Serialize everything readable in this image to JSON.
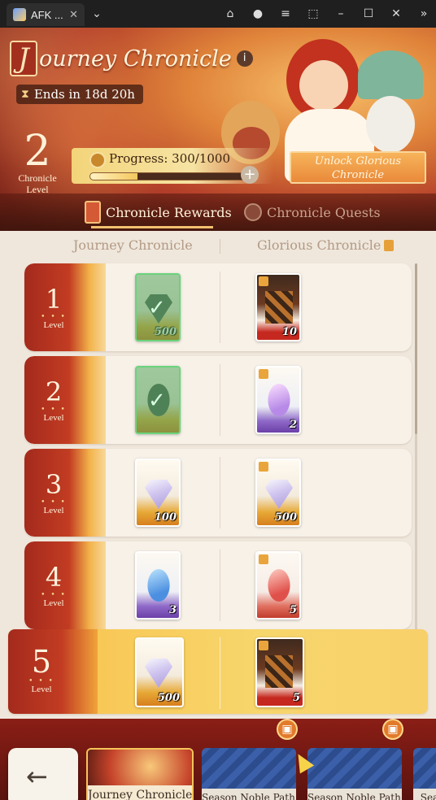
{
  "window": {
    "tab_title": "AFK ...",
    "close_glyph": "✕",
    "dropdown_glyph": "⌄",
    "controls": [
      "gift-icon",
      "account-icon",
      "menu-icon",
      "screenshot-icon",
      "minimize-icon",
      "maximize-icon",
      "close-icon",
      "chevron-right-icon"
    ]
  },
  "header": {
    "title_initial": "J",
    "title_rest": "ourney Chronicle",
    "info_label": "i",
    "ends_text": "Ends in 18d 20h",
    "level_number": "2",
    "level_caption_1": "Chronicle",
    "level_caption_2": "Level",
    "progress_text": "Progress: 300/1000",
    "progress_fraction": 0.3,
    "plus_label": "+",
    "unlock_button_line1": "Unlock Glorious",
    "unlock_button_line2": "Chronicle"
  },
  "tabs": [
    {
      "label": "Chronicle Rewards",
      "active": true
    },
    {
      "label": "Chronicle Quests",
      "active": false
    }
  ],
  "columns": {
    "left": "Journey Chronicle",
    "right": "Glorious Chronicle"
  },
  "rows": [
    {
      "level": "1",
      "level_label": "Level",
      "free_qty": "500",
      "free_claimed": true,
      "premium_qty": "10"
    },
    {
      "level": "2",
      "level_label": "Level",
      "free_qty": "",
      "free_claimed": true,
      "premium_qty": "2"
    },
    {
      "level": "3",
      "level_label": "Level",
      "free_qty": "100",
      "free_claimed": false,
      "premium_qty": "500"
    },
    {
      "level": "4",
      "level_label": "Level",
      "free_qty": "3",
      "free_claimed": false,
      "premium_qty": "5"
    },
    {
      "level": "5",
      "level_label": "Level",
      "free_qty": "500",
      "free_claimed": false,
      "premium_qty": "5"
    }
  ],
  "bottom_nav": {
    "back_label": "←",
    "items": [
      {
        "label": "Journey Chronicle",
        "active": true
      },
      {
        "label": "Season Noble Path I",
        "active": false
      },
      {
        "label": "Season Noble Path II",
        "active": false
      },
      {
        "label": "Sea",
        "active": false
      }
    ]
  },
  "colors": {
    "accent": "#f2c070",
    "banner_red": "#b5402a",
    "claimed_green": "#6bd37c"
  }
}
